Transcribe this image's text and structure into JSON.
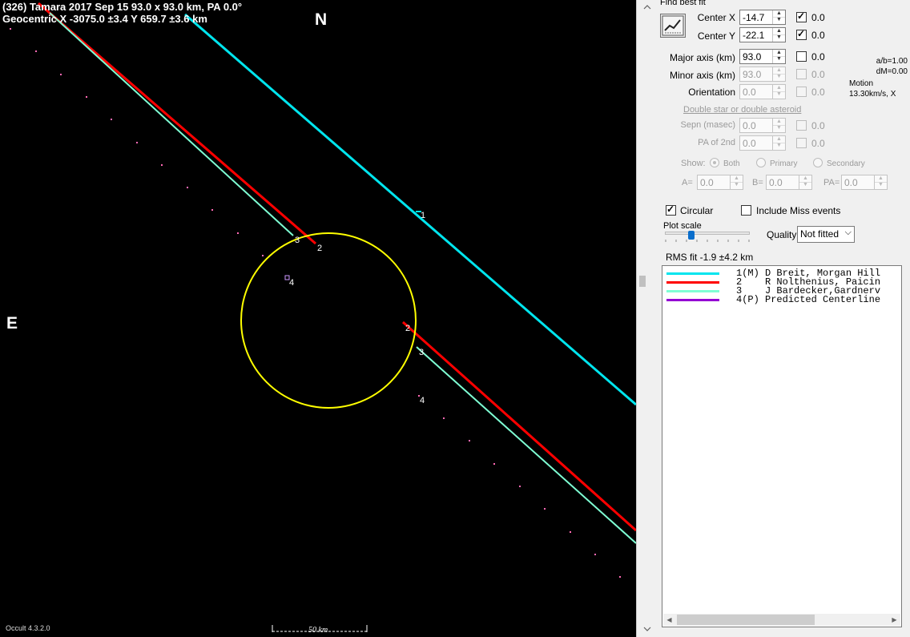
{
  "plot": {
    "title_line1": "(326) Tamara  2017 Sep 15   93.0 x 93.0 km,  PA 0.0°",
    "title_line2": "Geocentric  X  -3075.0 ±3.4  Y 659.7 ±3.6 km",
    "north": "N",
    "east": "E",
    "version": "Occult 4.3.2.0",
    "scale_label": "50 km",
    "chord_labels": {
      "c1": "1",
      "c2a": "2",
      "c2b": "2",
      "c3a": "3",
      "c3b": "3",
      "c4a": "4",
      "c4b": "4"
    },
    "colors": {
      "c1": "#00e5ee",
      "c2": "#ff0000",
      "c3": "#7fffd4",
      "ellipse": "#ffff00",
      "track": "#ff69b4",
      "predicted": "#9400d3"
    }
  },
  "panel": {
    "find_best_fit": "Find best fit",
    "center_x": {
      "label": "Center X",
      "value": "-14.7",
      "check_value": "0.0",
      "checked": true
    },
    "center_y": {
      "label": "Center Y",
      "value": "-22.1",
      "check_value": "0.0",
      "checked": true
    },
    "major_axis": {
      "label": "Major axis (km)",
      "value": "93.0",
      "check_value": "0.0",
      "checked": false
    },
    "minor_axis": {
      "label": "Minor axis (km)",
      "value": "93.0",
      "check_value": "0.0"
    },
    "orientation": {
      "label": "Orientation",
      "value": "0.0",
      "check_value": "0.0"
    },
    "ab_ratio": "a/b=1.00",
    "dm": "dM=0.00",
    "motion_label": "Motion",
    "motion_value": "13.30km/s, X",
    "double_star_link": "Double star  or  double asteroid",
    "sepn": {
      "label": "Sepn (masec)",
      "value": "0.0",
      "check_value": "0.0"
    },
    "pa_2nd": {
      "label": "PA of 2nd",
      "value": "0.0",
      "check_value": "0.0"
    },
    "show_label": "Show:",
    "show_options": [
      "Both",
      "Primary",
      "Secondary"
    ],
    "a_label": "A=",
    "a_value": "0.0",
    "b_label": "B=",
    "b_value": "0.0",
    "pa_label": "PA=",
    "pa_value": "0.0",
    "circular_label": "Circular",
    "include_miss_label": "Include Miss events",
    "plot_scale_label": "Plot scale",
    "quality_label": "Quality",
    "quality_value": "Not fitted",
    "rms_fit": "RMS fit -1.9 ±4.2 km"
  },
  "legend": [
    {
      "num": "1(M)",
      "name": "D Breit, Morgan Hill",
      "color": "#00e5ee"
    },
    {
      "num": "2   ",
      "name": "R Nolthenius, Paicin",
      "color": "#ff0000"
    },
    {
      "num": "3   ",
      "name": "J Bardecker,Gardnerv",
      "color": "#7fffd4"
    },
    {
      "num": "4(P)",
      "name": "Predicted Centerline",
      "color": "#9400d3"
    }
  ]
}
